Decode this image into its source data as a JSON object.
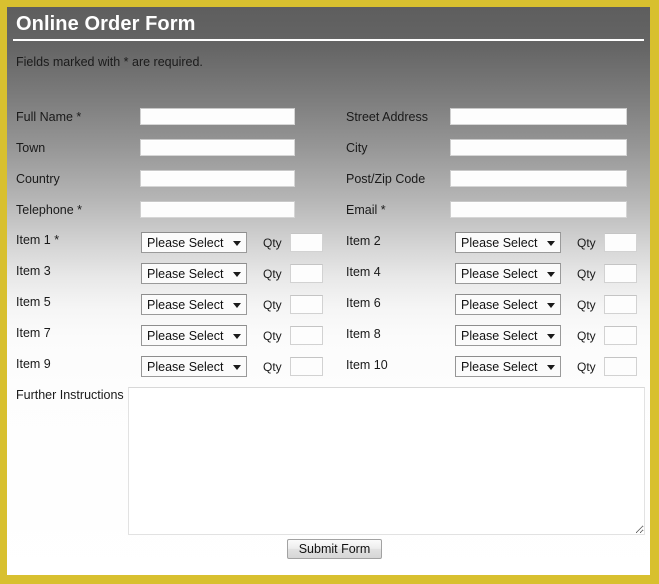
{
  "window": {
    "border_color": "#d8c02f",
    "background_top_color": "#5e5e5e",
    "background_bottom_color": "#ffffff"
  },
  "header": {
    "title": "Online Order Form",
    "required_note": "Fields marked with * are required."
  },
  "contact_fields": {
    "left": [
      {
        "label": "Full Name *",
        "value": "",
        "placeholder": ""
      },
      {
        "label": "Town",
        "value": "",
        "placeholder": ""
      },
      {
        "label": "Country",
        "value": "",
        "placeholder": ""
      },
      {
        "label": "Telephone *",
        "value": "",
        "placeholder": ""
      }
    ],
    "right": [
      {
        "label": "Street Address",
        "value": "",
        "placeholder": ""
      },
      {
        "label": "City",
        "value": "",
        "placeholder": ""
      },
      {
        "label": "Post/Zip Code",
        "value": "",
        "placeholder": ""
      },
      {
        "label": "Email *",
        "value": "",
        "placeholder": ""
      }
    ]
  },
  "items": {
    "select_placeholder": "Please Select",
    "qty_label": "Qty",
    "left": [
      {
        "label": "Item 1 *",
        "selected": "Please Select",
        "qty": ""
      },
      {
        "label": "Item 3",
        "selected": "Please Select",
        "qty": ""
      },
      {
        "label": "Item 5",
        "selected": "Please Select",
        "qty": ""
      },
      {
        "label": "Item 7",
        "selected": "Please Select",
        "qty": ""
      },
      {
        "label": "Item 9",
        "selected": "Please Select",
        "qty": ""
      }
    ],
    "right": [
      {
        "label": "Item 2",
        "selected": "Please Select",
        "qty": ""
      },
      {
        "label": "Item 4",
        "selected": "Please Select",
        "qty": ""
      },
      {
        "label": "Item 6",
        "selected": "Please Select",
        "qty": ""
      },
      {
        "label": "Item 8",
        "selected": "Please Select",
        "qty": ""
      },
      {
        "label": "Item 10",
        "selected": "Please Select",
        "qty": ""
      }
    ]
  },
  "instructions": {
    "label": "Further Instructions",
    "value": "",
    "placeholder": ""
  },
  "footer": {
    "submit_label": "Submit Form",
    "watermark": ""
  }
}
